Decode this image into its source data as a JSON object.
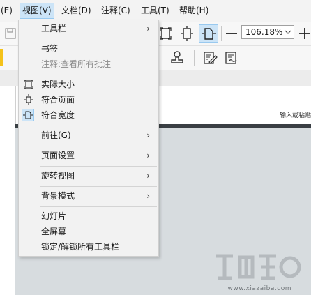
{
  "menubar": {
    "items": [
      {
        "label": "(E)"
      },
      {
        "label": "视图(V)"
      },
      {
        "label": "文档(D)"
      },
      {
        "label": "注释(C)"
      },
      {
        "label": "工具(T)"
      },
      {
        "label": "帮助(H)"
      }
    ],
    "active_index": 1
  },
  "toolbar": {
    "zoom_value": "106.18%",
    "zoom_icon": "chevron-down-icon",
    "icons": [
      "actual-size-icon",
      "fit-page-icon",
      "fit-width-icon",
      "zoom-out-icon",
      "zoom-in-icon",
      "stamp-icon",
      "edit-form-icon",
      "signature-icon"
    ]
  },
  "side_hint": "输入或粘贴",
  "view_menu": {
    "items": [
      {
        "label": "工具栏",
        "submenu": true
      },
      {
        "label": "书签"
      },
      {
        "label": "注释:查看所有批注",
        "disabled": true
      },
      {
        "label": "实际大小",
        "icon": "actual-size-icon"
      },
      {
        "label": "符合页面",
        "icon": "fit-page-icon"
      },
      {
        "label": "符合宽度",
        "icon": "fit-width-icon",
        "checked": true
      },
      {
        "label": "前往(G)",
        "submenu": true
      },
      {
        "label": "页面设置",
        "submenu": true
      },
      {
        "label": "旋转视图",
        "submenu": true
      },
      {
        "label": "背景模式",
        "submenu": true
      },
      {
        "label": "幻灯片"
      },
      {
        "label": "全屏幕"
      },
      {
        "label": "锁定/解锁所有工具栏"
      }
    ],
    "submenu_arrow": "›"
  },
  "watermark": {
    "sub": "www.xiazaiba.com"
  },
  "colors": {
    "highlight": "#cce4f7",
    "highlight_border": "#99c9ef",
    "menu_bg": "#f2f2f2",
    "page_bg": "#d7dcdf"
  }
}
